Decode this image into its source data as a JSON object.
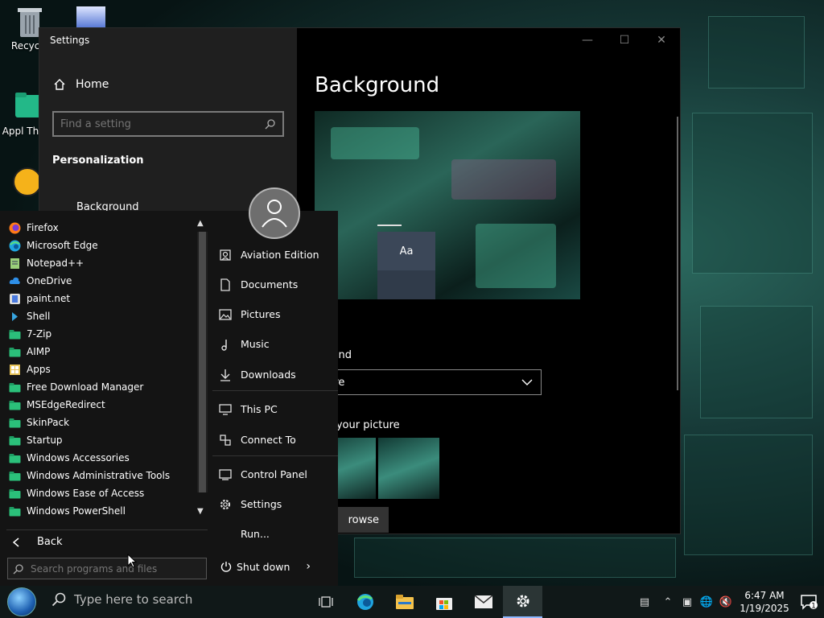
{
  "desktop": {
    "icons": [
      {
        "label": "Recycle",
        "icon": "recycle-bin-icon"
      },
      {
        "label": "Appl Them",
        "icon": "folder-icon"
      }
    ]
  },
  "settings_window": {
    "title": "Settings",
    "home_label": "Home",
    "search_placeholder": "Find a setting",
    "section": "Personalization",
    "nav_item": "Background",
    "page_title": "Background",
    "preview_tile_text": "Aa",
    "background_label": "ground",
    "background_value": "ture",
    "choose_label": "ose your picture",
    "browse_label": "rowse"
  },
  "start_menu": {
    "programs": [
      {
        "label": "Firefox",
        "icon": "firefox-icon",
        "color": "#ff7a1a"
      },
      {
        "label": "Microsoft Edge",
        "icon": "edge-icon",
        "color": "#1fa4e0"
      },
      {
        "label": "Notepad++",
        "icon": "notepad-icon",
        "color": "#9ad07a"
      },
      {
        "label": "OneDrive",
        "icon": "cloud-icon",
        "color": "#2e8fe8"
      },
      {
        "label": "paint.net",
        "icon": "paint-icon",
        "color": "#4a7adf"
      },
      {
        "label": "Shell",
        "icon": "shell-icon",
        "color": "#37a5e0"
      },
      {
        "label": "7-Zip",
        "icon": "folder-icon",
        "color": "#2bc07a"
      },
      {
        "label": "AIMP",
        "icon": "folder-icon",
        "color": "#2bc07a"
      },
      {
        "label": "Apps",
        "icon": "apps-icon",
        "color": "#e8c45a"
      },
      {
        "label": "Free Download Manager",
        "icon": "folder-icon",
        "color": "#2bc07a"
      },
      {
        "label": "MSEdgeRedirect",
        "icon": "folder-icon",
        "color": "#2bc07a"
      },
      {
        "label": "SkinPack",
        "icon": "folder-icon",
        "color": "#2bc07a"
      },
      {
        "label": "Startup",
        "icon": "folder-icon",
        "color": "#2bc07a"
      },
      {
        "label": "Windows Accessories",
        "icon": "folder-icon",
        "color": "#2bc07a"
      },
      {
        "label": "Windows Administrative Tools",
        "icon": "folder-icon",
        "color": "#2bc07a"
      },
      {
        "label": "Windows Ease of Access",
        "icon": "folder-icon",
        "color": "#2bc07a"
      },
      {
        "label": "Windows PowerShell",
        "icon": "folder-icon",
        "color": "#2bc07a"
      }
    ],
    "back_label": "Back",
    "search_placeholder": "Search programs and files",
    "right_items": [
      {
        "label": "Aviation Edition",
        "icon": "user-folder-icon"
      },
      {
        "label": "Documents",
        "icon": "document-icon"
      },
      {
        "label": "Pictures",
        "icon": "picture-icon"
      },
      {
        "label": "Music",
        "icon": "music-icon"
      },
      {
        "label": "Downloads",
        "icon": "download-icon"
      },
      {
        "label": "This PC",
        "icon": "monitor-icon"
      },
      {
        "label": "Connect To",
        "icon": "connect-icon"
      },
      {
        "label": "Control Panel",
        "icon": "control-panel-icon"
      },
      {
        "label": "Settings",
        "icon": "gear-icon"
      },
      {
        "label": "Run...",
        "icon": "run-icon"
      }
    ],
    "shutdown_label": "Shut down"
  },
  "taskbar": {
    "search_placeholder": "Type here to search",
    "apps": [
      {
        "name": "task-view-icon"
      },
      {
        "name": "edge-icon"
      },
      {
        "name": "file-explorer-icon"
      },
      {
        "name": "store-icon"
      },
      {
        "name": "mail-icon"
      },
      {
        "name": "settings-icon"
      }
    ],
    "time": "6:47 AM",
    "date": "1/19/2025",
    "notification_count": "1"
  }
}
